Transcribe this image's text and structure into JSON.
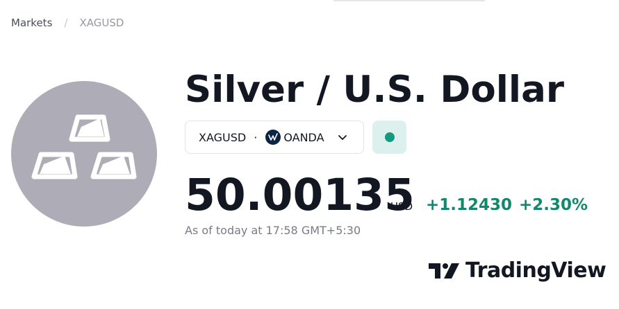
{
  "breadcrumb": {
    "root": "Markets",
    "separator": "/",
    "current": "XAGUSD"
  },
  "symbol": {
    "icon": "silver-bars-icon",
    "title": "Silver / U.S. Dollar",
    "ticker": "XAGUSD",
    "separator_dot": "·",
    "broker": "OANDA",
    "broker_icon": "oanda-icon",
    "status_color": "#139a7e"
  },
  "quote": {
    "price": "50.00135",
    "currency": "USD",
    "change_abs": "+1.12430",
    "change_pct": "+2.30%",
    "change_color": "#12876c",
    "timestamp": "As of today at 17:58 GMT+5:30"
  },
  "brand": {
    "icon": "tradingview-logo-icon",
    "name": "TradingView"
  }
}
